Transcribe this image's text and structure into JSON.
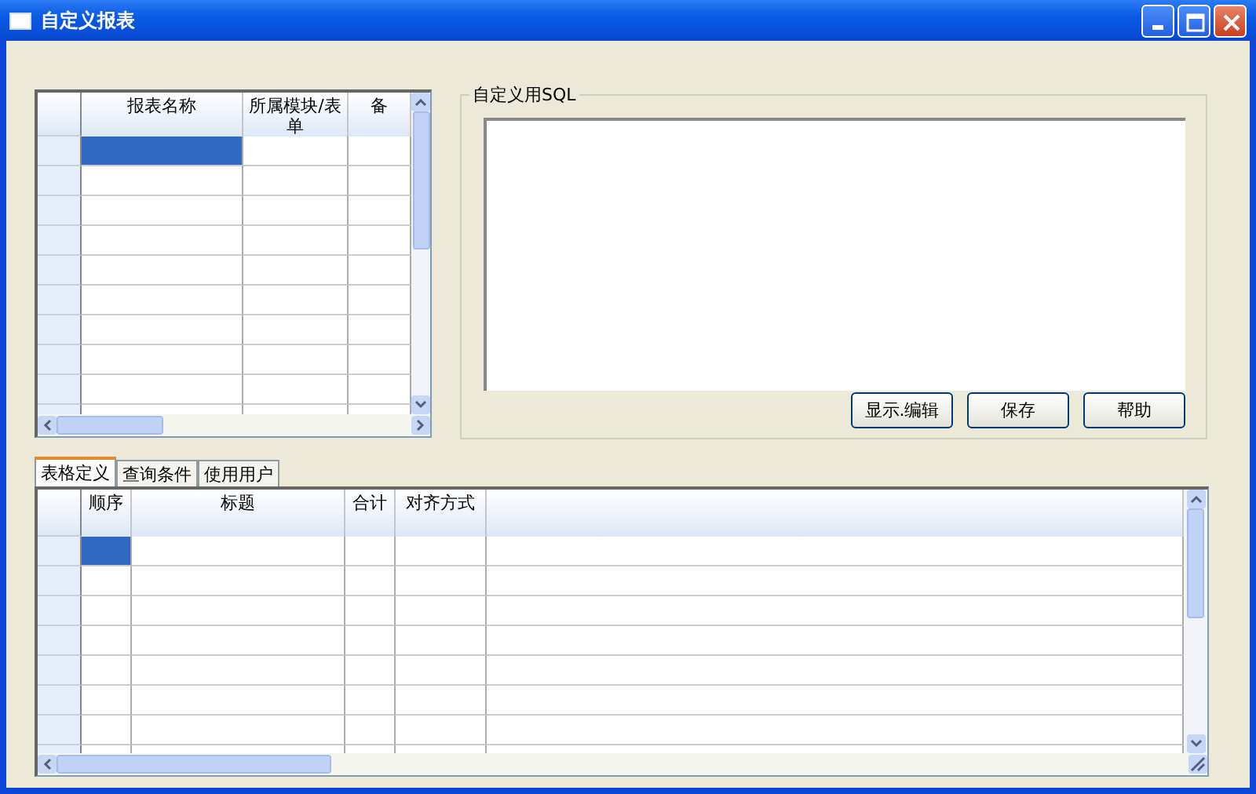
{
  "window": {
    "title": "自定义报表"
  },
  "report_grid": {
    "columns": [
      "报表名称",
      "所属模块/表单",
      "备"
    ],
    "rows": [
      {
        "selected": true
      },
      {
        "selected": false
      },
      {
        "selected": false
      },
      {
        "selected": false
      },
      {
        "selected": false
      },
      {
        "selected": false
      },
      {
        "selected": false
      },
      {
        "selected": false
      },
      {
        "selected": false
      },
      {
        "selected": false
      }
    ]
  },
  "sql_group": {
    "label": "自定义用SQL",
    "buttons": [
      "显示.编辑",
      "保存",
      "帮助"
    ]
  },
  "tabs": [
    {
      "label": "表格定义",
      "selected": true
    },
    {
      "label": "查询条件",
      "selected": false
    },
    {
      "label": "使用用户",
      "selected": false
    }
  ],
  "column_grid": {
    "columns": [
      "顺序",
      "标题",
      "合计",
      "对齐方式"
    ],
    "rows": [
      {
        "selected": true
      },
      {
        "selected": false
      },
      {
        "selected": false
      },
      {
        "selected": false
      },
      {
        "selected": false
      },
      {
        "selected": false
      },
      {
        "selected": false
      },
      {
        "selected": false
      }
    ]
  }
}
